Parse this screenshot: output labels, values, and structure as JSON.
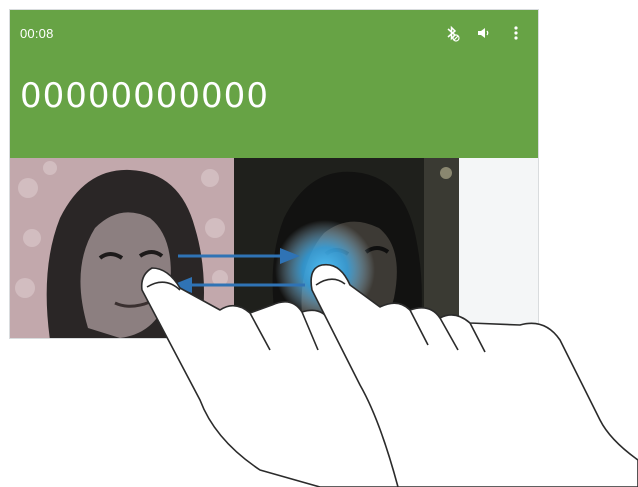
{
  "call": {
    "timer": "00:08",
    "number": "00000000000"
  },
  "icons": {
    "bluetooth": "bluetooth-off-icon",
    "speaker": "speaker-icon",
    "menu": "more-vert-icon"
  },
  "colors": {
    "header": "#67a345",
    "arrow": "#2f73b5",
    "touch": "#39a7e6"
  }
}
